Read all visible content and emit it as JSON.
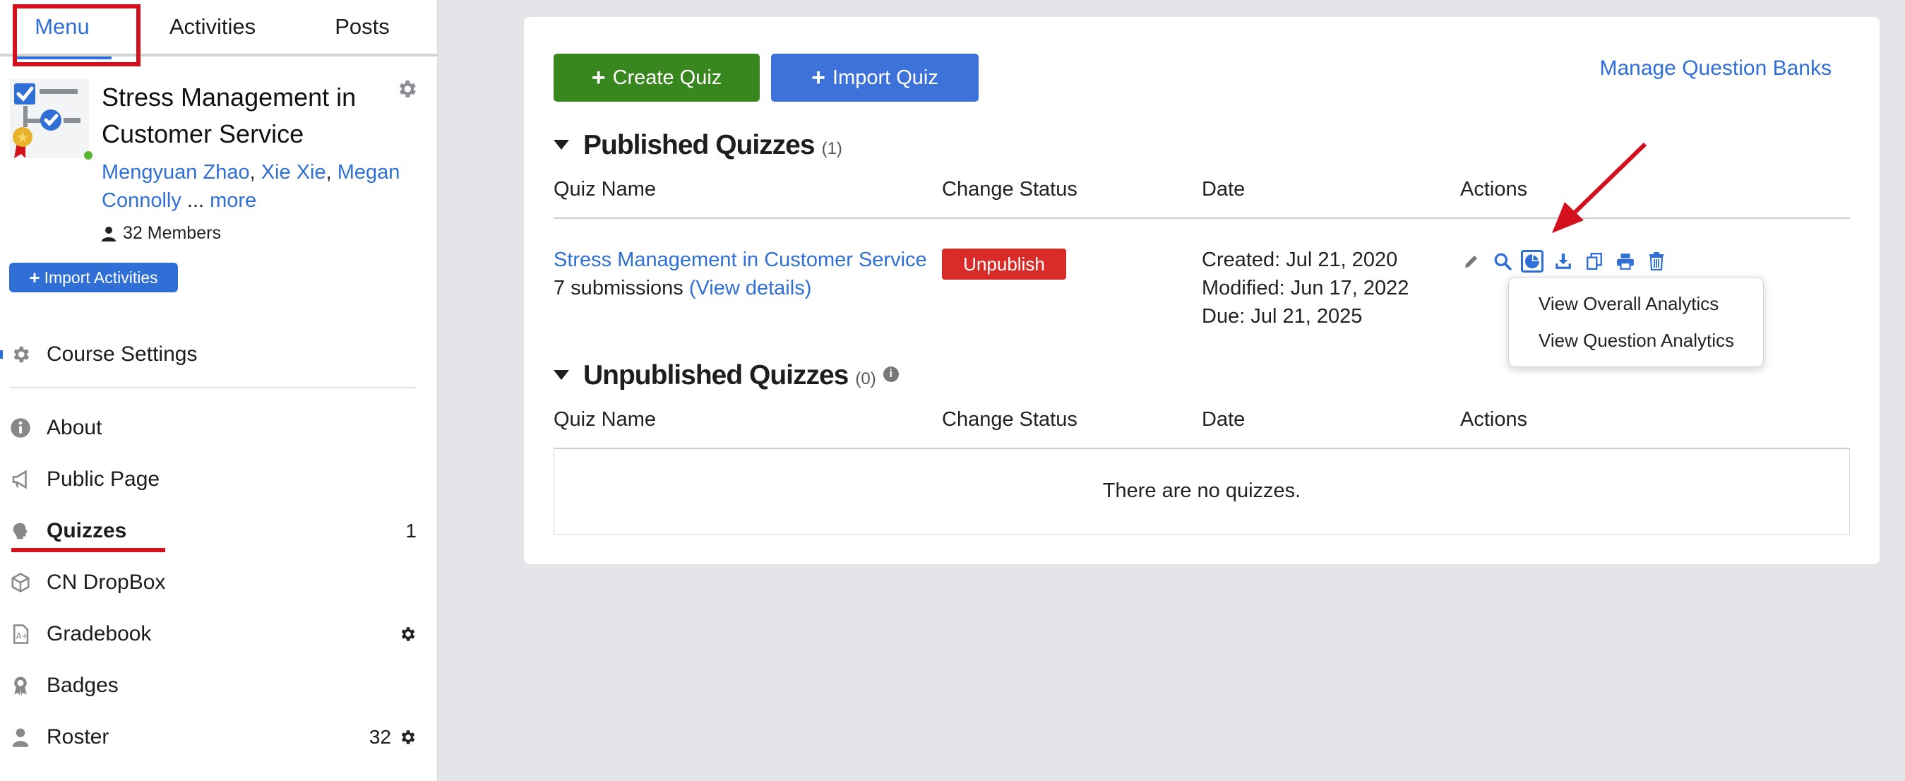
{
  "tabs": [
    {
      "label": "Menu"
    },
    {
      "label": "Activities"
    },
    {
      "label": "Posts"
    }
  ],
  "course": {
    "title": "Stress Management in Customer Service",
    "instructors": [
      "Mengyuan Zhao",
      "Xie Xie",
      "Megan Connolly"
    ],
    "more_label": "more",
    "members_label": "32 Members",
    "import_activities_label": "Import Activities"
  },
  "nav": {
    "course_settings": "Course Settings",
    "items": [
      {
        "label": "About",
        "icon": "info-circle-icon"
      },
      {
        "label": "Public Page",
        "icon": "megaphone-icon"
      },
      {
        "label": "Quizzes",
        "icon": "brain-icon",
        "count": "1"
      },
      {
        "label": "CN DropBox",
        "icon": "cube-icon"
      },
      {
        "label": "Gradebook",
        "icon": "grade-file-icon"
      },
      {
        "label": "Badges",
        "icon": "award-icon"
      },
      {
        "label": "Roster",
        "icon": "person-icon",
        "count": "32"
      }
    ]
  },
  "toolbar": {
    "create_quiz_label": "Create Quiz",
    "import_quiz_label": "Import Quiz",
    "manage_banks_label": "Manage Question Banks"
  },
  "published": {
    "title": "Published Quizzes",
    "count": "(1)",
    "columns": [
      "Quiz Name",
      "Change Status",
      "Date",
      "Actions"
    ],
    "quizzes": [
      {
        "name": "Stress Management in Customer Service",
        "submissions": "7 submissions",
        "view_details": "(View details)",
        "status_button": "Unpublish",
        "created": "Created: Jul 21, 2020",
        "modified": "Modified: Jun 17, 2022",
        "due": "Due: Jul 21, 2025"
      }
    ],
    "actions": [
      "pencil-icon",
      "magnifier-icon",
      "pie-chart-icon",
      "download-icon",
      "copy-icon",
      "print-icon",
      "trash-icon"
    ],
    "analytics_menu": [
      "View Overall Analytics",
      "View Question Analytics"
    ]
  },
  "unpublished": {
    "title": "Unpublished Quizzes",
    "count": "(0)",
    "columns": [
      "Quiz Name",
      "Change Status",
      "Date",
      "Actions"
    ],
    "empty_message": "There are no quizzes."
  },
  "colors": {
    "accent_blue": "#2f6fd6",
    "create_green": "#37861e",
    "unpublish_red": "#d92b27",
    "annotation_red": "#d3101d"
  }
}
